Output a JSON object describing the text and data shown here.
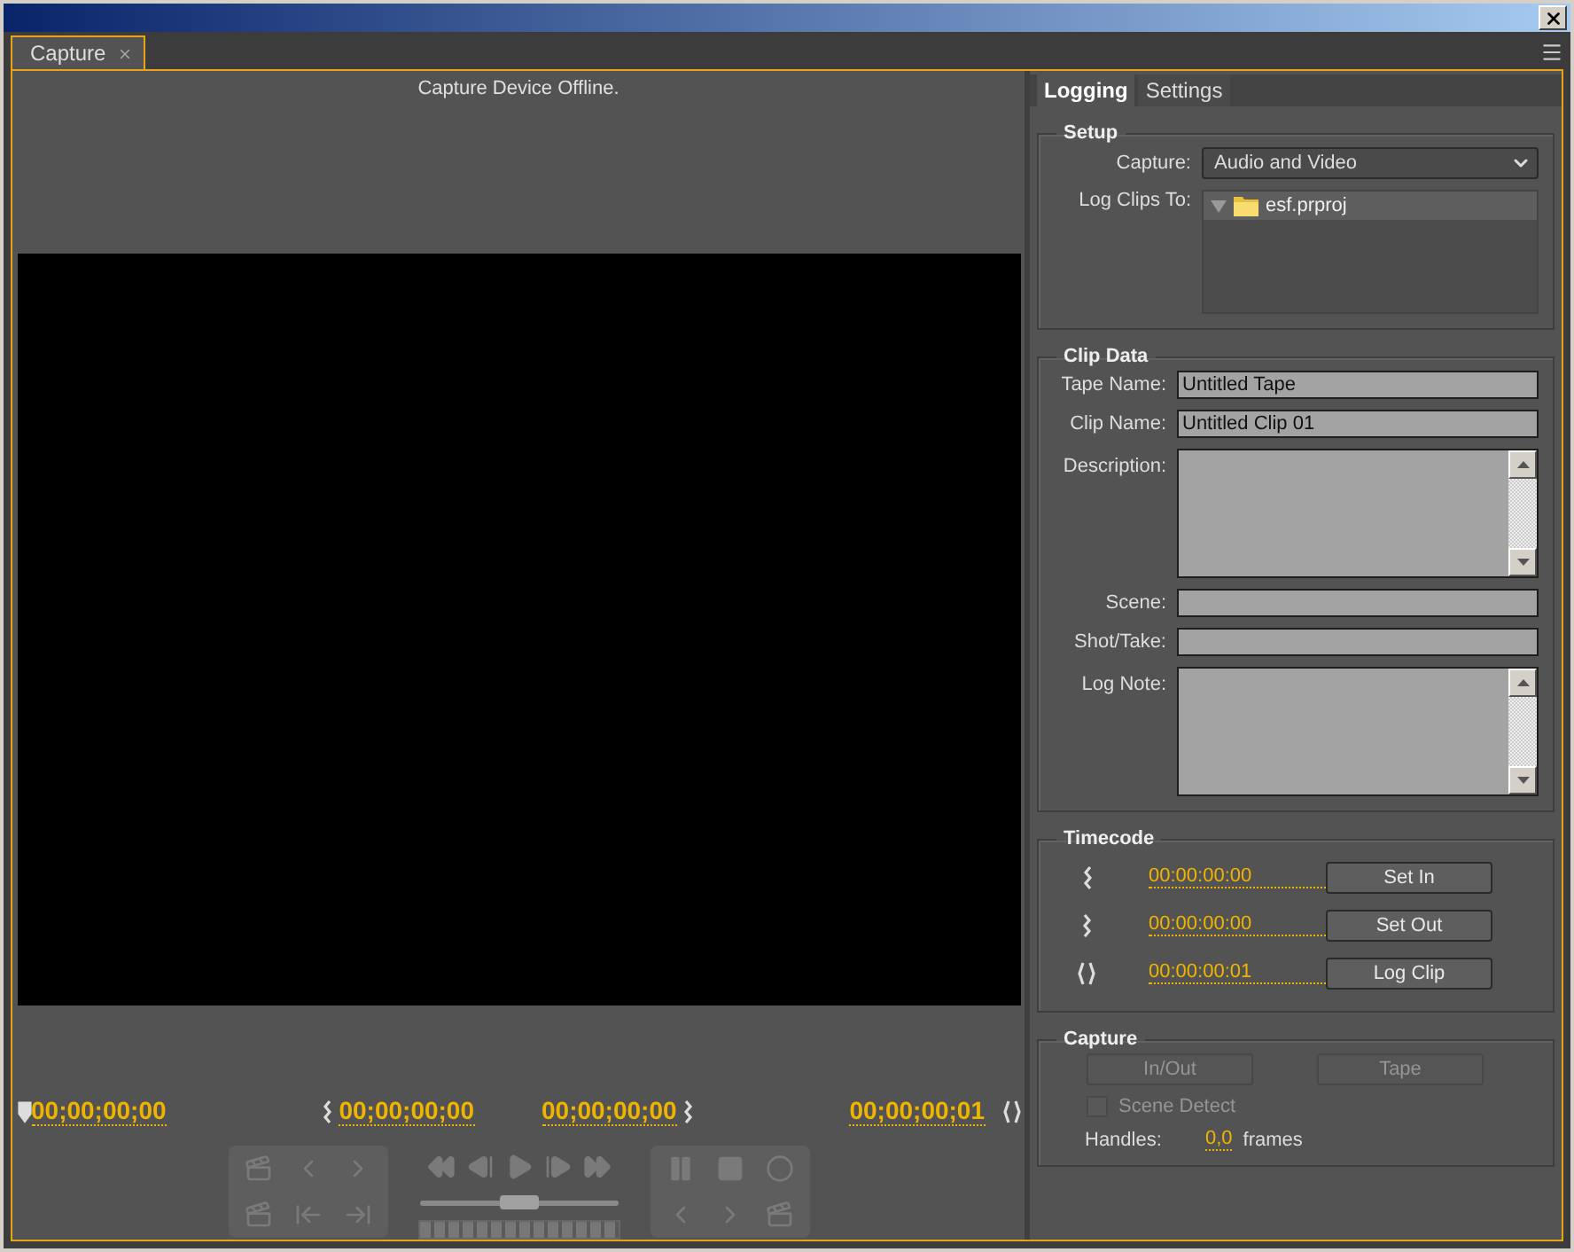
{
  "panel_tab": {
    "label": "Capture",
    "selected": true
  },
  "monitor": {
    "status": "Capture Device Offline."
  },
  "timecodes": [
    {
      "kind": "current",
      "value": "00;00;00;00"
    },
    {
      "kind": "in",
      "value": "00;00;00;00"
    },
    {
      "kind": "out",
      "value": "00;00;00;00"
    },
    {
      "kind": "duration",
      "value": "00;00;00;01"
    }
  ],
  "shuttle": {
    "level": 0.5
  },
  "tabs": [
    {
      "label": "Logging",
      "selected": true
    },
    {
      "label": "Settings",
      "selected": false
    }
  ],
  "setup": {
    "title": "Setup",
    "capture_label": "Capture:",
    "capture_value": "Audio and Video",
    "log_label": "Log Clips To:",
    "project": {
      "name": "esf.prproj",
      "expanded": true
    }
  },
  "clip_data": {
    "title": "Clip Data",
    "fields": [
      {
        "kind": "line",
        "label": "Tape Name:",
        "value": "Untitled Tape"
      },
      {
        "kind": "line",
        "label": "Clip Name:",
        "value": "Untitled Clip 01"
      },
      {
        "kind": "area",
        "label": "Description:"
      },
      {
        "kind": "line",
        "label": "Scene:"
      },
      {
        "kind": "line",
        "label": "Shot/Take:"
      },
      {
        "kind": "area",
        "label": "Log Note:"
      }
    ]
  },
  "timecode": {
    "title": "Timecode",
    "rows": [
      {
        "kind": "in",
        "value": "00:00:00:00",
        "button": "Set In"
      },
      {
        "kind": "out",
        "value": "00:00:00:00",
        "button": "Set Out"
      },
      {
        "kind": "duration",
        "value": "00:00:00:01",
        "button": "Log Clip"
      }
    ]
  },
  "capture": {
    "title": "Capture",
    "buttons": [
      {
        "label": "In/Out",
        "disabled": true
      },
      {
        "label": "Tape",
        "disabled": true
      }
    ],
    "scene_detect": {
      "label": "Scene Detect",
      "checked": false,
      "disabled": true
    },
    "handles_label": "Handles:",
    "handles_value": "0,0",
    "handles_unit": "frames"
  }
}
